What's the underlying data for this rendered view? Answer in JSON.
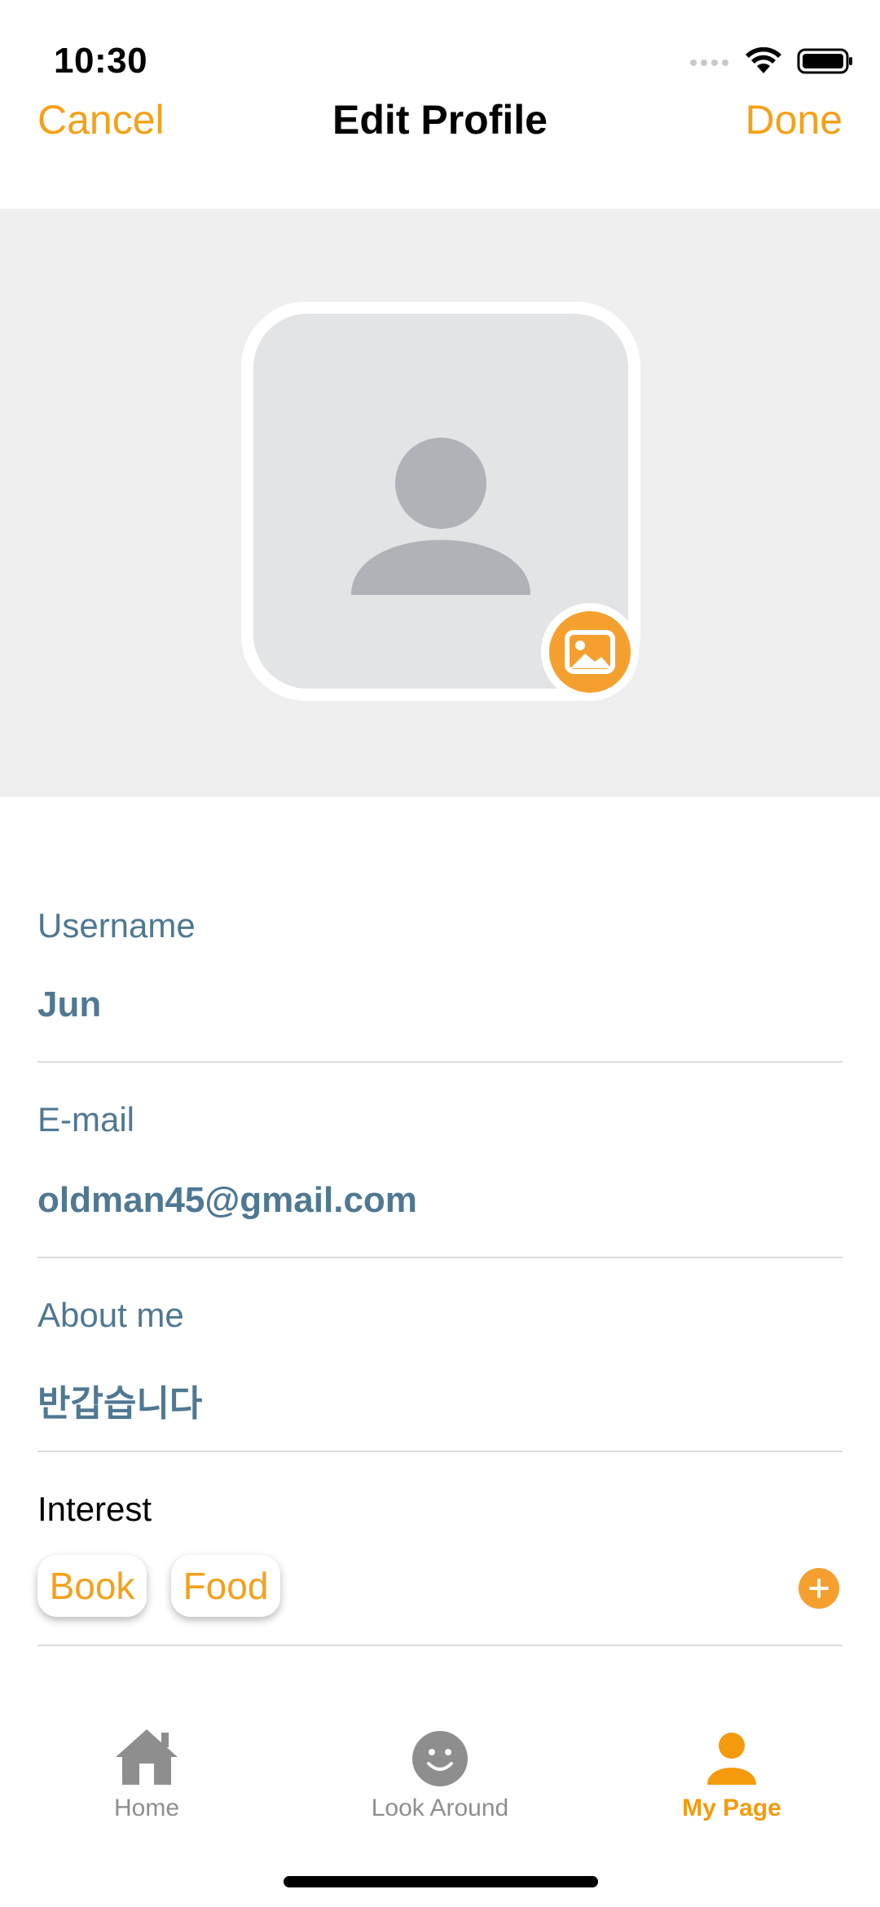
{
  "status_bar": {
    "time": "10:30"
  },
  "nav": {
    "cancel_label": "Cancel",
    "title": "Edit Profile",
    "done_label": "Done"
  },
  "profile": {
    "avatar_icon": "person-placeholder-icon",
    "photo_button_icon": "image-icon"
  },
  "form": {
    "username": {
      "label": "Username",
      "value": "Jun"
    },
    "email": {
      "label": "E-mail",
      "value": "oldman45@gmail.com"
    },
    "about": {
      "label": "About me",
      "value": "반갑습니다"
    },
    "interest": {
      "label": "Interest",
      "chips": [
        "Book",
        "Food"
      ],
      "add_icon": "plus-circle-icon"
    }
  },
  "tab_bar": {
    "items": [
      {
        "label": "Home",
        "icon": "home-icon",
        "active": false
      },
      {
        "label": "Look Around",
        "icon": "smiley-icon",
        "active": false
      },
      {
        "label": "My Page",
        "icon": "person-icon",
        "active": true
      }
    ]
  },
  "colors": {
    "accent": "#f5a019",
    "field_text": "#4f7892",
    "header_bg": "#efefef",
    "inactive_tab": "#8e8e8e"
  }
}
